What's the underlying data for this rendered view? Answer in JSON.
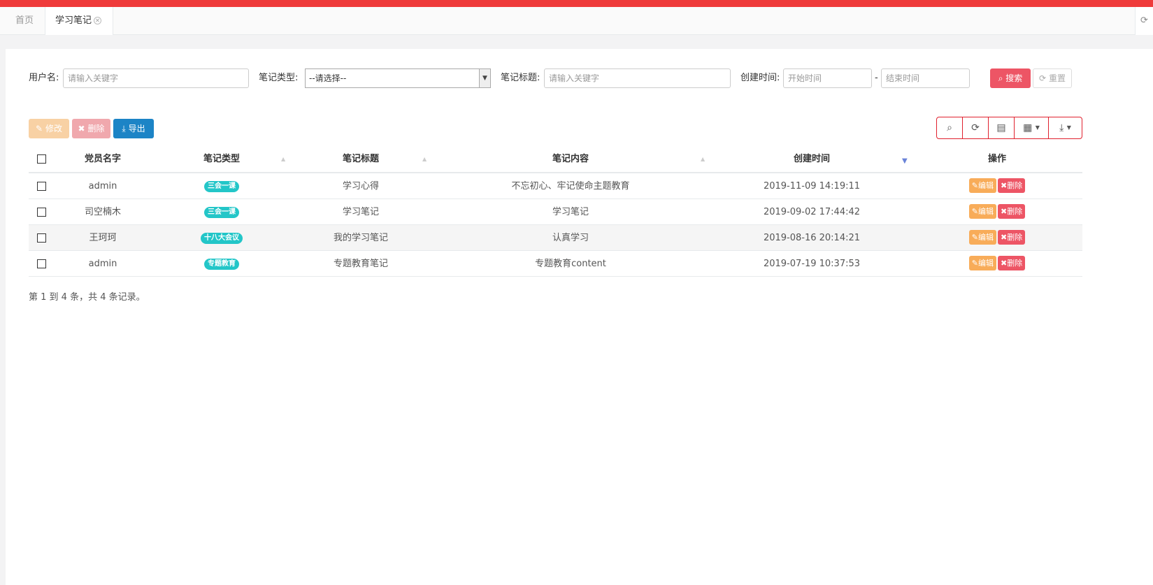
{
  "tabs": {
    "home_label": "首页",
    "active_label": "学习笔记",
    "refresh_icon": "refresh-icon"
  },
  "search": {
    "username_label": "用户名:",
    "username_placeholder": "请输入关键字",
    "type_label": "笔记类型:",
    "type_selected": "--请选择--",
    "title_label": "笔记标题:",
    "title_placeholder": "请输入关键字",
    "time_label": "创建时间:",
    "start_placeholder": "开始时间",
    "range_sep": "-",
    "end_placeholder": "结束时间",
    "search_label": "搜索",
    "reset_label": "重置"
  },
  "toolbar": {
    "edit_label": "修改",
    "delete_label": "删除",
    "export_label": "导出"
  },
  "table": {
    "headers": {
      "name": "党员名字",
      "type": "笔记类型",
      "title": "笔记标题",
      "content": "笔记内容",
      "time": "创建时间",
      "op": "操作"
    },
    "op_edit": "编辑",
    "op_delete": "删除",
    "rows": [
      {
        "name": "admin",
        "type": "三会一课",
        "title": "学习心得",
        "content": "不忘初心、牢记使命主题教育",
        "time": "2019-11-09 14:19:11"
      },
      {
        "name": "司空楠木",
        "type": "三会一课",
        "title": "学习笔记",
        "content": "学习笔记",
        "time": "2019-09-02 17:44:42"
      },
      {
        "name": "王珂珂",
        "type": "十八大会议",
        "title": "我的学习笔记",
        "content": "认真学习",
        "time": "2019-08-16 20:14:21"
      },
      {
        "name": "admin",
        "type": "专题教育",
        "title": "专题教育笔记",
        "content": "专题教育content",
        "time": "2019-07-19 10:37:53"
      }
    ]
  },
  "pagination": {
    "summary": "第 1 到 4 条，共 4 条记录。"
  },
  "colors": {
    "topbar": "#ef3a3a",
    "search_button": "#ed5565",
    "export_button": "#1c84c6",
    "badge": "#23c6c8",
    "edit_op": "#f8ac59",
    "delete_op": "#ed5565"
  }
}
